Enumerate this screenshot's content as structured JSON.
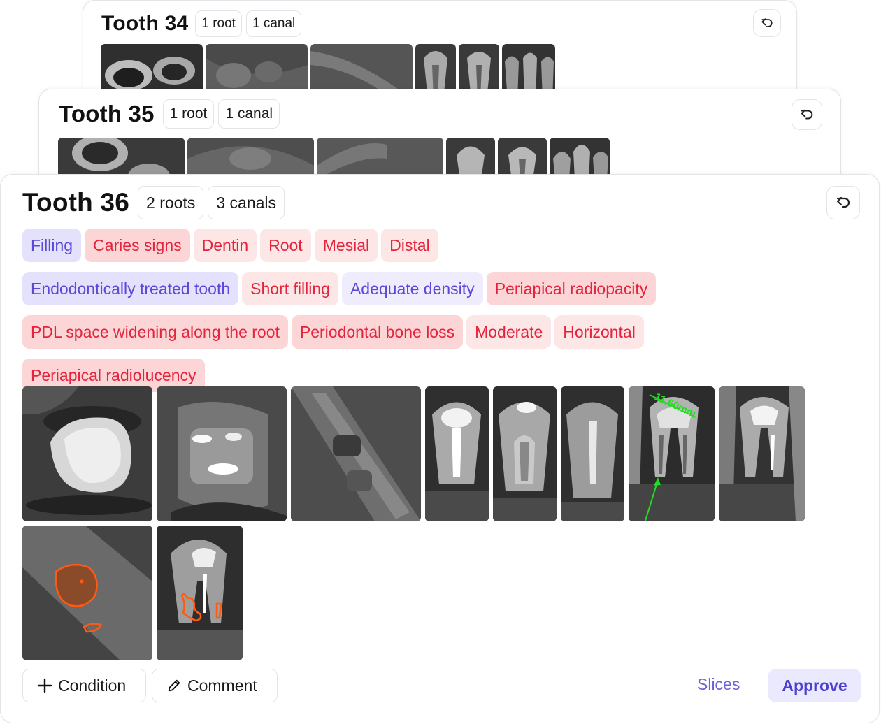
{
  "cards": {
    "tooth34": {
      "title": "Tooth 34",
      "roots": "1 root",
      "canals": "1 canal"
    },
    "tooth35": {
      "title": "Tooth 35",
      "roots": "1 root",
      "canals": "1 canal"
    },
    "tooth36": {
      "title": "Tooth 36",
      "roots": "2 roots",
      "canals": "3 canals",
      "tags": [
        {
          "label": "Filling",
          "style": "blue"
        },
        {
          "label": "Caries signs",
          "style": "red"
        },
        {
          "label": "Dentin",
          "style": "pink"
        },
        {
          "label": "Root",
          "style": "pink"
        },
        {
          "label": "Mesial",
          "style": "pink"
        },
        {
          "label": "Distal",
          "style": "pink"
        },
        {
          "label": "Endodontically treated tooth",
          "style": "blue"
        },
        {
          "label": "Short filling",
          "style": "pink"
        },
        {
          "label": "Adequate density",
          "style": "lavender"
        },
        {
          "label": "Periapical radiopacity",
          "style": "red"
        },
        {
          "label": "PDL space widening along the root",
          "style": "red"
        },
        {
          "label": "Periodontal bone loss",
          "style": "red"
        },
        {
          "label": "Moderate",
          "style": "pink"
        },
        {
          "label": "Horizontal",
          "style": "pink"
        },
        {
          "label": "Periapical radiolucency",
          "style": "red"
        }
      ],
      "measurement": "11.60mm",
      "actions": {
        "condition": "Condition",
        "comment": "Comment",
        "slices": "Slices",
        "approve": "Approve"
      }
    }
  },
  "icons": {
    "undo": "undo-icon",
    "plus": "plus-icon",
    "pencil": "pencil-icon"
  },
  "colors": {
    "accent": "#5a49d6",
    "alert": "#e5233c",
    "annotation_green": "#22dd22",
    "segmentation_orange": "#ff5a12"
  }
}
